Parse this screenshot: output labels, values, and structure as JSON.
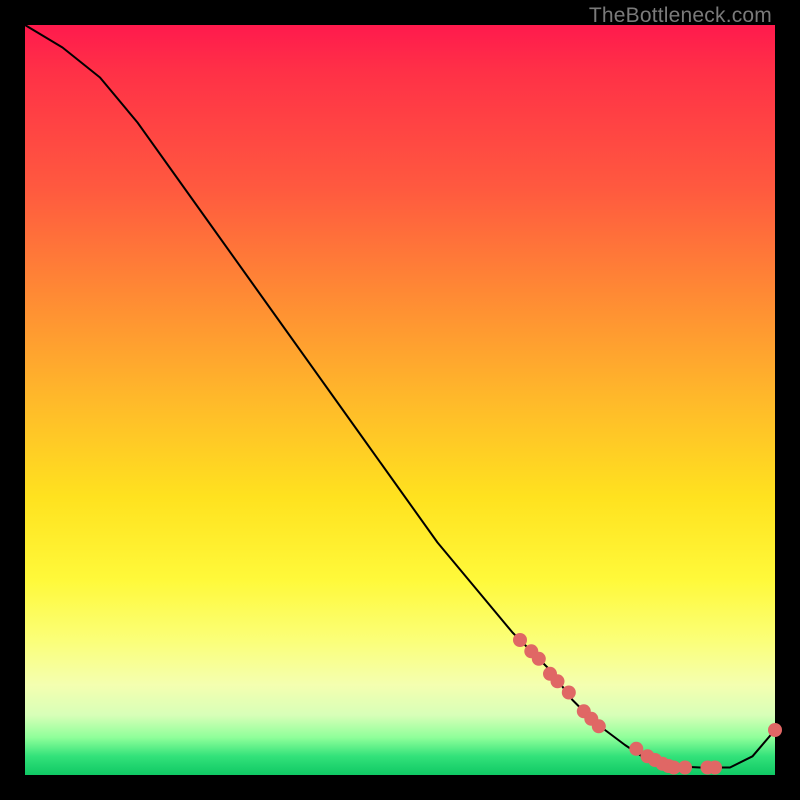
{
  "watermark": "TheBottleneck.com",
  "chart_data": {
    "type": "line",
    "title": "",
    "xlabel": "",
    "ylabel": "",
    "xlim": [
      0,
      100
    ],
    "ylim": [
      0,
      100
    ],
    "grid": false,
    "legend": false,
    "series": [
      {
        "name": "bottleneck-curve",
        "color": "#000000",
        "x": [
          0,
          5,
          10,
          15,
          20,
          25,
          30,
          35,
          40,
          45,
          50,
          55,
          60,
          65,
          70,
          73,
          76,
          80,
          83,
          86,
          90,
          94,
          97,
          100
        ],
        "y": [
          100,
          97,
          93,
          87,
          80,
          73,
          66,
          59,
          52,
          45,
          38,
          31,
          25,
          19,
          14,
          10,
          7,
          4,
          2,
          1.2,
          1,
          1,
          2.5,
          6
        ]
      }
    ],
    "markers": [
      {
        "name": "dot-cluster",
        "color": "#e06765",
        "radius_px": 7,
        "points": [
          {
            "x": 66,
            "y": 18
          },
          {
            "x": 67.5,
            "y": 16.5
          },
          {
            "x": 68.5,
            "y": 15.5
          },
          {
            "x": 70,
            "y": 13.5
          },
          {
            "x": 71,
            "y": 12.5
          },
          {
            "x": 72.5,
            "y": 11
          },
          {
            "x": 74.5,
            "y": 8.5
          },
          {
            "x": 75.5,
            "y": 7.5
          },
          {
            "x": 76.5,
            "y": 6.5
          },
          {
            "x": 81.5,
            "y": 3.5
          },
          {
            "x": 83,
            "y": 2.5
          },
          {
            "x": 84,
            "y": 2
          },
          {
            "x": 85,
            "y": 1.5
          },
          {
            "x": 85.8,
            "y": 1.2
          },
          {
            "x": 86.5,
            "y": 1
          },
          {
            "x": 88,
            "y": 1
          },
          {
            "x": 91,
            "y": 1
          },
          {
            "x": 92,
            "y": 1
          },
          {
            "x": 100,
            "y": 6
          }
        ]
      }
    ]
  }
}
